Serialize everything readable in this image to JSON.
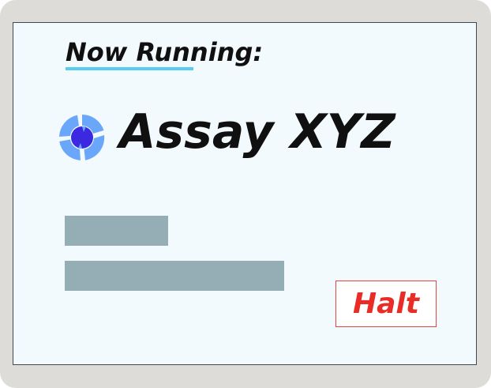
{
  "status": {
    "heading": "Now Running:",
    "assay_name": "Assay XYZ",
    "icon": "loading-spinner-icon"
  },
  "placeholders": {
    "bar_count": 2
  },
  "controls": {
    "halt_label": "Halt"
  },
  "colors": {
    "screen_background": "#f3fafd",
    "underline_accent": "#56ccee",
    "spinner_outer": "#6aa6fa",
    "spinner_inner": "#3b28e0",
    "placeholder_bar": "#95adb5",
    "halt_text": "#e92c25",
    "halt_border": "#e5453f"
  }
}
